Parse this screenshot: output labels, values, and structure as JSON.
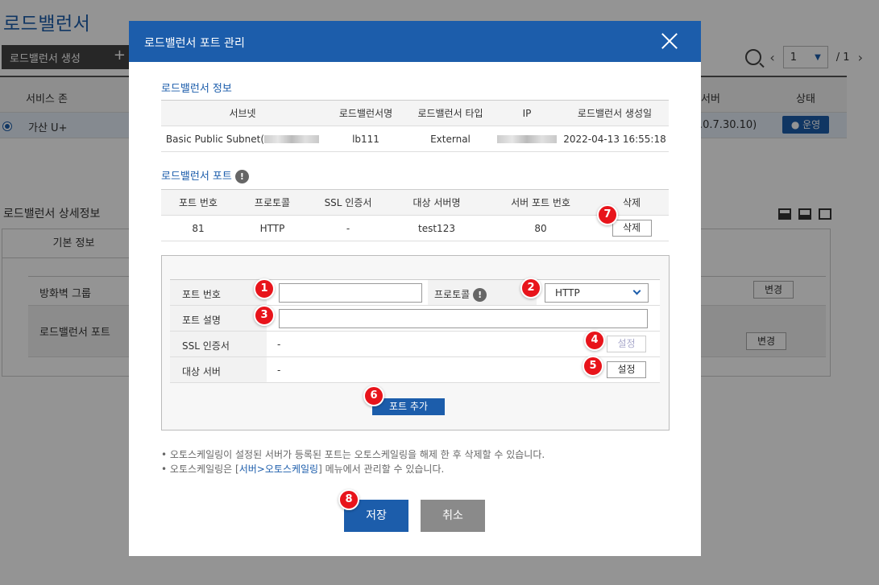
{
  "background": {
    "page_title": "로드밸런서",
    "create_button": "로드밸런서 생성",
    "create_plus": "+",
    "pager": {
      "current": "1",
      "total": "/ 1"
    },
    "columns": {
      "zone": "서비스 존",
      "server": "서버",
      "status": "상태"
    },
    "row": {
      "zone": "가산 U+",
      "server_ip": ".0.7.30.10)",
      "status": "● 운영"
    },
    "detail_title": "로드밸런서 상세정보",
    "detail_tab": "기본 정보",
    "detail_rows": {
      "firewall": "방화벽 그룹",
      "lb_port": "로드밸런서 포트"
    },
    "change_button": "변경"
  },
  "modal": {
    "title": "로드밸런서 포트 관리",
    "info_section_title": "로드밸런서 정보",
    "info_columns": [
      "서브넷",
      "로드밸런서명",
      "로드밸런서 타입",
      "IP",
      "로드밸런서 생성일"
    ],
    "info_row": {
      "subnet": "Basic Public Subnet(",
      "name": "lb111",
      "type": "External",
      "created": "2022-04-13 16:55:18"
    },
    "port_section_title": "로드밸런서 포트",
    "port_columns": [
      "포트 번호",
      "프로토콜",
      "SSL 인증서",
      "대상 서버명",
      "서버 포트 번호",
      "삭제"
    ],
    "port_row": {
      "port": "81",
      "protocol": "HTTP",
      "ssl": "-",
      "target": "test123",
      "server_port": "80",
      "delete_label": "삭제"
    },
    "form": {
      "port_number_label": "포트 번호",
      "port_number_value": "",
      "protocol_label": "프로토콜",
      "protocol_value": "HTTP",
      "port_desc_label": "포트 설명",
      "port_desc_value": "",
      "ssl_label": "SSL 인증서",
      "ssl_value": "-",
      "ssl_button": "설정",
      "target_label": "대상 서버",
      "target_value": "-",
      "target_button": "설정",
      "add_button": "포트 추가"
    },
    "notes": [
      "오토스케일링이 설정된 서버가 등록된 포트는 오토스케일링을 해제 한 후 삭제할 수 있습니다.",
      "오토스케일링은 [",
      "서버>오토스케일링",
      "] 메뉴에서 관리할 수 있습니다."
    ],
    "save_button": "저장",
    "cancel_button": "취소"
  },
  "markers": [
    "1",
    "2",
    "3",
    "4",
    "5",
    "6",
    "7",
    "8"
  ],
  "colors": {
    "primary": "#1c5dab",
    "marker": "#e8141b",
    "cancel": "#8a8a8a"
  }
}
